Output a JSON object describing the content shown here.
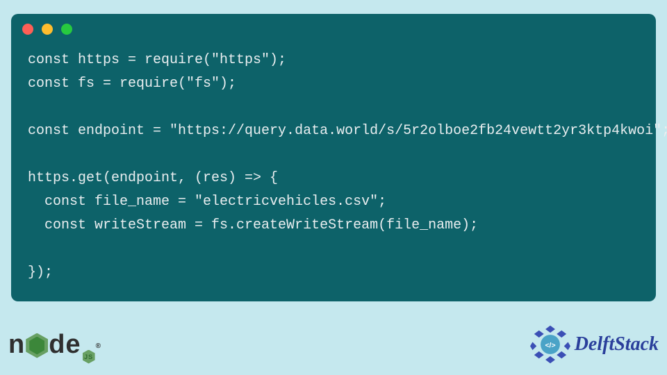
{
  "code": {
    "line1": "const https = require(\"https\");",
    "line2": "const fs = require(\"fs\");",
    "line3": "",
    "line4": "const endpoint = \"https://query.data.world/s/5r2olboe2fb24vewtt2yr3ktp4kwoi\";",
    "line5": "",
    "line6": "https.get(endpoint, (res) => {",
    "line7": "  const file_name = \"electricvehicles.csv\";",
    "line8": "  const writeStream = fs.createWriteStream(file_name);",
    "line9": "",
    "line10": "});"
  },
  "logos": {
    "node_n": "n",
    "node_de": "de",
    "node_js": "JS",
    "node_reg": "®",
    "delft": "DelftStack"
  }
}
